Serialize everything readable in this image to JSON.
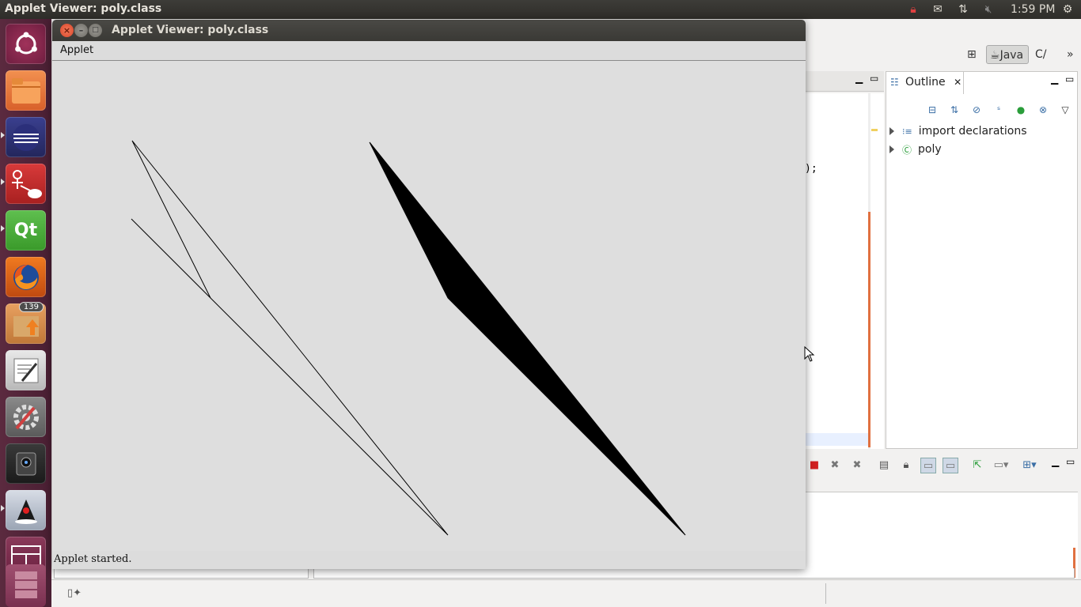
{
  "top_panel": {
    "title": "Applet Viewer: poly.class",
    "clock": "1:59 PM",
    "tray_icons": [
      "lock-icon",
      "mail-icon",
      "network-icon",
      "volume-muted-icon",
      "settings-gear-icon"
    ]
  },
  "launcher": {
    "items": [
      {
        "name": "ubuntu-dash",
        "icon": "ubuntu-logo-icon"
      },
      {
        "name": "files",
        "icon": "folder-icon"
      },
      {
        "name": "eclipse",
        "icon": "eclipse-icon"
      },
      {
        "name": "umbrello",
        "icon": "uml-icon"
      },
      {
        "name": "qt-creator",
        "icon": "qt-icon",
        "label": "Qt"
      },
      {
        "name": "firefox",
        "icon": "firefox-icon"
      },
      {
        "name": "software-updater",
        "icon": "update-icon",
        "badge": "139"
      },
      {
        "name": "text-editor",
        "icon": "text-editor-icon"
      },
      {
        "name": "system-settings",
        "icon": "system-settings-icon"
      },
      {
        "name": "webcam",
        "icon": "webcam-icon"
      },
      {
        "name": "java",
        "icon": "java-icon"
      },
      {
        "name": "workspace-switcher",
        "icon": "workspaces-icon"
      },
      {
        "name": "trash",
        "icon": "trash-icon"
      }
    ]
  },
  "eclipse": {
    "perspective_java": "Java",
    "perspective_cpp": "C/",
    "overflow": "»",
    "outline_tab": "Outline",
    "outline_items": [
      {
        "label": "import declarations",
        "icon": "imports-icon"
      },
      {
        "label": "poly",
        "icon": "class-icon"
      }
    ],
    "editor_fragment": ");"
  },
  "applet_window": {
    "title": "Applet Viewer: poly.class",
    "menu": "Applet",
    "status": "Applet started.",
    "colors": {
      "background": "#dedede",
      "stroke": "#000000",
      "fill": "#000000"
    }
  }
}
